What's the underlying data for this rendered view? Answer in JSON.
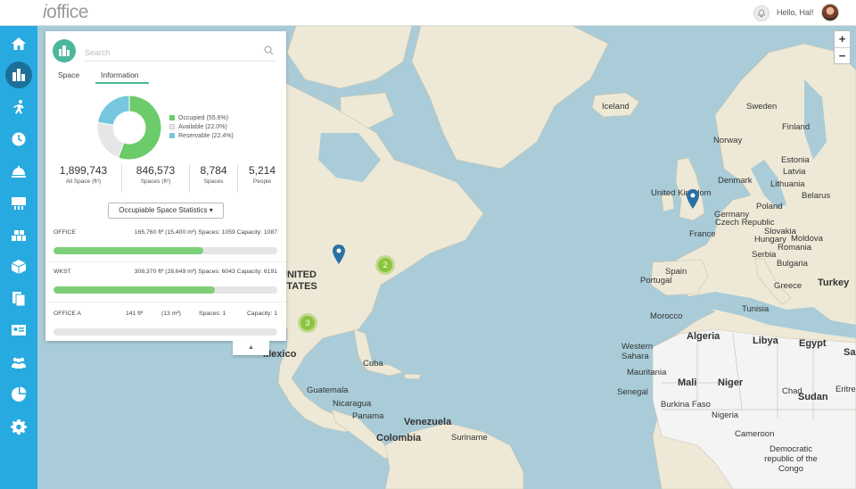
{
  "header": {
    "logo_prefix": "i",
    "logo_text": "office",
    "greeting": "Hello, Hal!"
  },
  "sidebar": {
    "items": [
      {
        "name": "home-icon",
        "active": false
      },
      {
        "name": "buildings-icon",
        "active": true
      },
      {
        "name": "move-icon",
        "active": false
      },
      {
        "name": "clock-icon",
        "active": false
      },
      {
        "name": "service-bell-icon",
        "active": false
      },
      {
        "name": "kiosk-icon",
        "active": false
      },
      {
        "name": "inventory-icon",
        "active": false
      },
      {
        "name": "box-icon",
        "active": false
      },
      {
        "name": "documents-icon",
        "active": false
      },
      {
        "name": "id-card-icon",
        "active": false
      },
      {
        "name": "people-icon",
        "active": false
      },
      {
        "name": "pie-chart-icon",
        "active": false
      },
      {
        "name": "gear-icon",
        "active": false
      }
    ]
  },
  "panel": {
    "search_placeholder": "Search",
    "tabs": [
      {
        "label": "Space"
      },
      {
        "label": "Information",
        "active": true
      }
    ],
    "legend": [
      {
        "label": "Occupied (55.6%)",
        "color": "#6ccb6a"
      },
      {
        "label": "Available (22.0%)",
        "color": "#e8e8e8"
      },
      {
        "label": "Reservable (22.4%)",
        "color": "#76c7de"
      }
    ],
    "donut": {
      "occupied": 55.6,
      "available": 22.0,
      "reservable": 22.4
    },
    "stats": [
      {
        "value": "1,899,743",
        "label": "All Space (ft²)"
      },
      {
        "value": "846,573",
        "label": "Spaces (ft²)"
      },
      {
        "value": "8,784",
        "label": "Spaces"
      },
      {
        "value": "5,214",
        "label": "People"
      }
    ],
    "dropdown": "Occupiable Space Statistics",
    "rows": [
      {
        "name": "OFFICE",
        "meta": "165,760 ft² (15,400 m²) Spaces: 1059 Capacity: 1087",
        "fill": 0.67
      },
      {
        "name": "WKST",
        "meta": "308,370 ft² (28,649 m²) Spaces: 6043 Capacity: 6191",
        "fill": 0.72
      },
      {
        "name": "OFFICE A",
        "area_ft": "141 ft²",
        "area_m": "(13 m²)",
        "spaces": "Spaces: 1",
        "capacity": "Capacity: 1",
        "fill": 0.0
      }
    ]
  },
  "map": {
    "zoom_in": "+",
    "zoom_out": "−",
    "clusters": [
      "2",
      "3"
    ],
    "labels": {
      "iceland": "Iceland",
      "sweden": "Sweden",
      "finland": "Finland",
      "norway": "Norway",
      "estonia": "Estonia",
      "latvia": "Latvia",
      "lithuania": "Lithuania",
      "denmark": "Denmark",
      "belarus": "Belarus",
      "uk": "United Kingdom",
      "poland": "Poland",
      "germany": "Germany",
      "czech": "Czech Republic",
      "slovakia": "Slovakia",
      "hungary": "Hungary",
      "moldova": "Moldova",
      "france": "France",
      "romania": "Romania",
      "serbia": "Serbia",
      "bulgaria": "Bulgaria",
      "spain": "Spain",
      "portugal": "Portugal",
      "greece": "Greece",
      "turkey": "Turkey",
      "tunisia": "Tunisia",
      "morocco": "Morocco",
      "algeria": "Algeria",
      "libya": "Libya",
      "egypt": "Egypt",
      "westernsahara": "Western Sahara",
      "mauritania": "Mauritania",
      "mali": "Mali",
      "niger": "Niger",
      "chad": "Chad",
      "sudan": "Sudan",
      "eritrea": "Eritre",
      "senegal": "Senegal",
      "burkina": "Burkina Faso",
      "nigeria": "Nigeria",
      "cameroon": "Cameroon",
      "drc": "Democratic republic of the Congo",
      "us": "UNITED STATES",
      "mexico": "Mexico",
      "cuba": "Cuba",
      "guatemala": "Guatemala",
      "nicaragua": "Nicaragua",
      "panama": "Panama",
      "venezuela": "Venezuela",
      "colombia": "Colombia",
      "suriname": "Suriname",
      "sa": "Sa"
    }
  }
}
